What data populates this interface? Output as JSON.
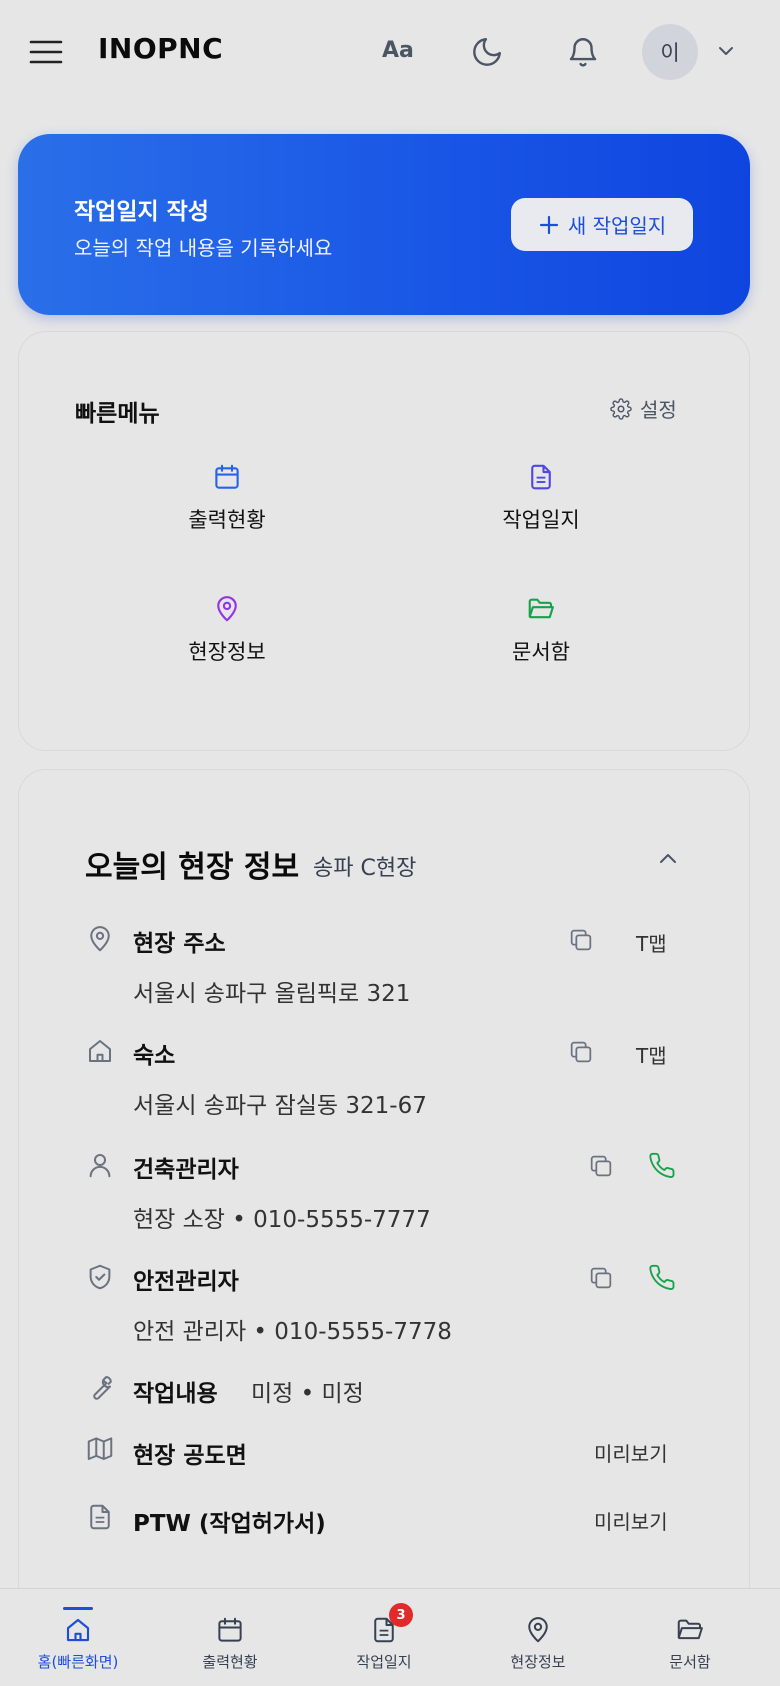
{
  "header": {
    "brand": "INOPNC",
    "font_size_label": "Aa",
    "avatar_initial": "이"
  },
  "hero": {
    "title": "작업일지 작성",
    "subtitle": "오늘의 작업 내용을 기록하세요",
    "button_label": "새 작업일지"
  },
  "quick_menu": {
    "title": "빠른메뉴",
    "settings_label": "설정",
    "items": [
      {
        "label": "출력현황",
        "icon": "calendar-icon",
        "color": "#2563eb"
      },
      {
        "label": "작업일지",
        "icon": "document-icon",
        "color": "#4f46e5"
      },
      {
        "label": "현장정보",
        "icon": "map-pin-icon",
        "color": "#9333ea"
      },
      {
        "label": "문서함",
        "icon": "folder-open-icon",
        "color": "#16a34a"
      }
    ]
  },
  "site_info": {
    "title": "오늘의 현장 정보",
    "site_name": "송파 C현장",
    "rows": {
      "address": {
        "label": "현장 주소",
        "value": "서울시 송파구 올림픽로 321",
        "action": "T맵"
      },
      "lodging": {
        "label": "숙소",
        "value": "서울시 송파구 잠실동 321-67",
        "action": "T맵"
      },
      "building_manager": {
        "label": "건축관리자",
        "value": "현장 소장 • 010-5555-7777"
      },
      "safety_manager": {
        "label": "안전관리자",
        "value": "안전 관리자 • 010-5555-7778"
      },
      "work_content": {
        "label": "작업내용",
        "value": "미정 • 미정"
      },
      "blueprint": {
        "label": "현장 공도면",
        "action": "미리보기"
      },
      "ptw": {
        "label": "PTW (작업허가서)",
        "action": "미리보기"
      }
    }
  },
  "bottom_nav": {
    "items": [
      {
        "label": "홈(빠른화면)",
        "active": true
      },
      {
        "label": "출력현황"
      },
      {
        "label": "작업일지",
        "badge": "3"
      },
      {
        "label": "현장정보"
      },
      {
        "label": "문서함"
      }
    ]
  },
  "colors": {
    "accent": "#1d4ed8",
    "phone": "#16a34a",
    "badge": "#e12a2a"
  }
}
